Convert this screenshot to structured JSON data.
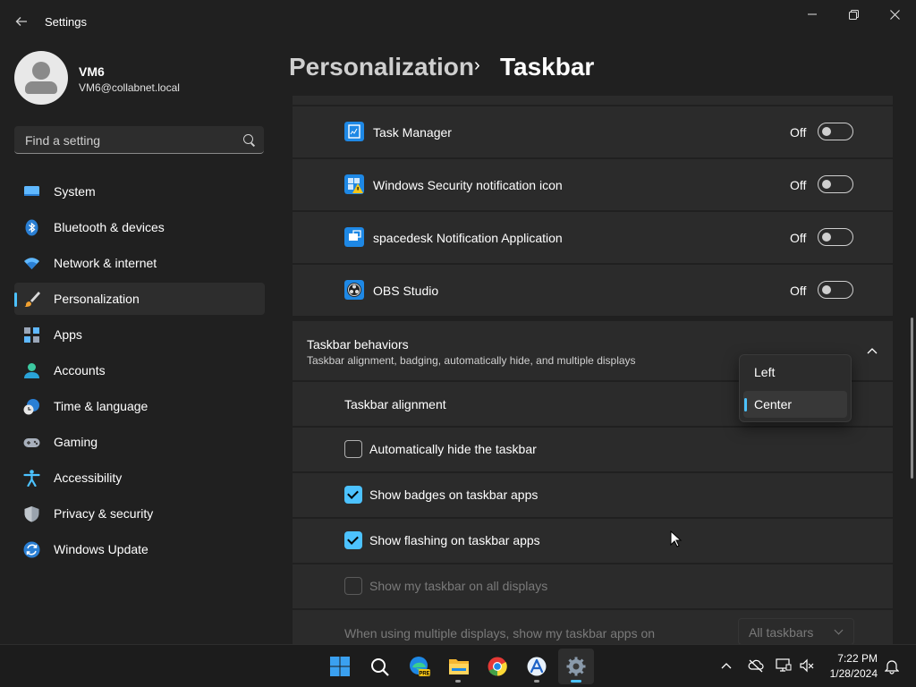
{
  "window": {
    "title": "Settings",
    "controls": [
      "minimize",
      "restore",
      "close"
    ]
  },
  "profile": {
    "name": "VM6",
    "email": "VM6@collabnet.local"
  },
  "search": {
    "placeholder": "Find a setting"
  },
  "nav": {
    "items": [
      {
        "label": "System",
        "icon": "system-icon"
      },
      {
        "label": "Bluetooth & devices",
        "icon": "bluetooth-icon"
      },
      {
        "label": "Network & internet",
        "icon": "wifi-icon"
      },
      {
        "label": "Personalization",
        "icon": "brush-icon",
        "selected": true
      },
      {
        "label": "Apps",
        "icon": "apps-icon"
      },
      {
        "label": "Accounts",
        "icon": "accounts-icon"
      },
      {
        "label": "Time & language",
        "icon": "globe-clock-icon"
      },
      {
        "label": "Gaming",
        "icon": "controller-icon"
      },
      {
        "label": "Accessibility",
        "icon": "accessibility-icon"
      },
      {
        "label": "Privacy & security",
        "icon": "shield-icon"
      },
      {
        "label": "Windows Update",
        "icon": "update-icon"
      }
    ]
  },
  "breadcrumb": {
    "parent": "Personalization",
    "separator": "›",
    "current": "Taskbar"
  },
  "tray_apps": [
    {
      "label": "Task Manager",
      "state": "Off"
    },
    {
      "label": "Windows Security notification icon",
      "state": "Off"
    },
    {
      "label": "spacedesk Notification Application",
      "state": "Off"
    },
    {
      "label": "OBS Studio",
      "state": "Off"
    }
  ],
  "behaviors": {
    "title": "Taskbar behaviors",
    "subtitle": "Taskbar alignment, badging, automatically hide, and multiple displays",
    "alignment_label": "Taskbar alignment",
    "alignment_options": [
      "Left",
      "Center"
    ],
    "alignment_selected": "Center",
    "auto_hide": {
      "label": "Automatically hide the taskbar",
      "checked": false
    },
    "badges": {
      "label": "Show badges on taskbar apps",
      "checked": true
    },
    "flashing": {
      "label": "Show flashing on taskbar apps",
      "checked": true
    },
    "all_displays": {
      "label": "Show my taskbar on all displays",
      "checked": false,
      "disabled": true
    },
    "multi_display": {
      "label": "When using multiple displays, show my taskbar apps on",
      "value": "All taskbars",
      "disabled": true
    }
  },
  "taskbar": {
    "apps": [
      "start-icon",
      "search-icon",
      "edge-beta-icon",
      "file-explorer-icon",
      "chrome-icon",
      "app-store-icon",
      "settings-icon"
    ],
    "active_app": "settings-icon",
    "time": "7:22 PM",
    "date": "1/28/2024"
  },
  "colors": {
    "accent": "#4cc2ff",
    "background": "#202020",
    "card": "#2b2b2b"
  }
}
